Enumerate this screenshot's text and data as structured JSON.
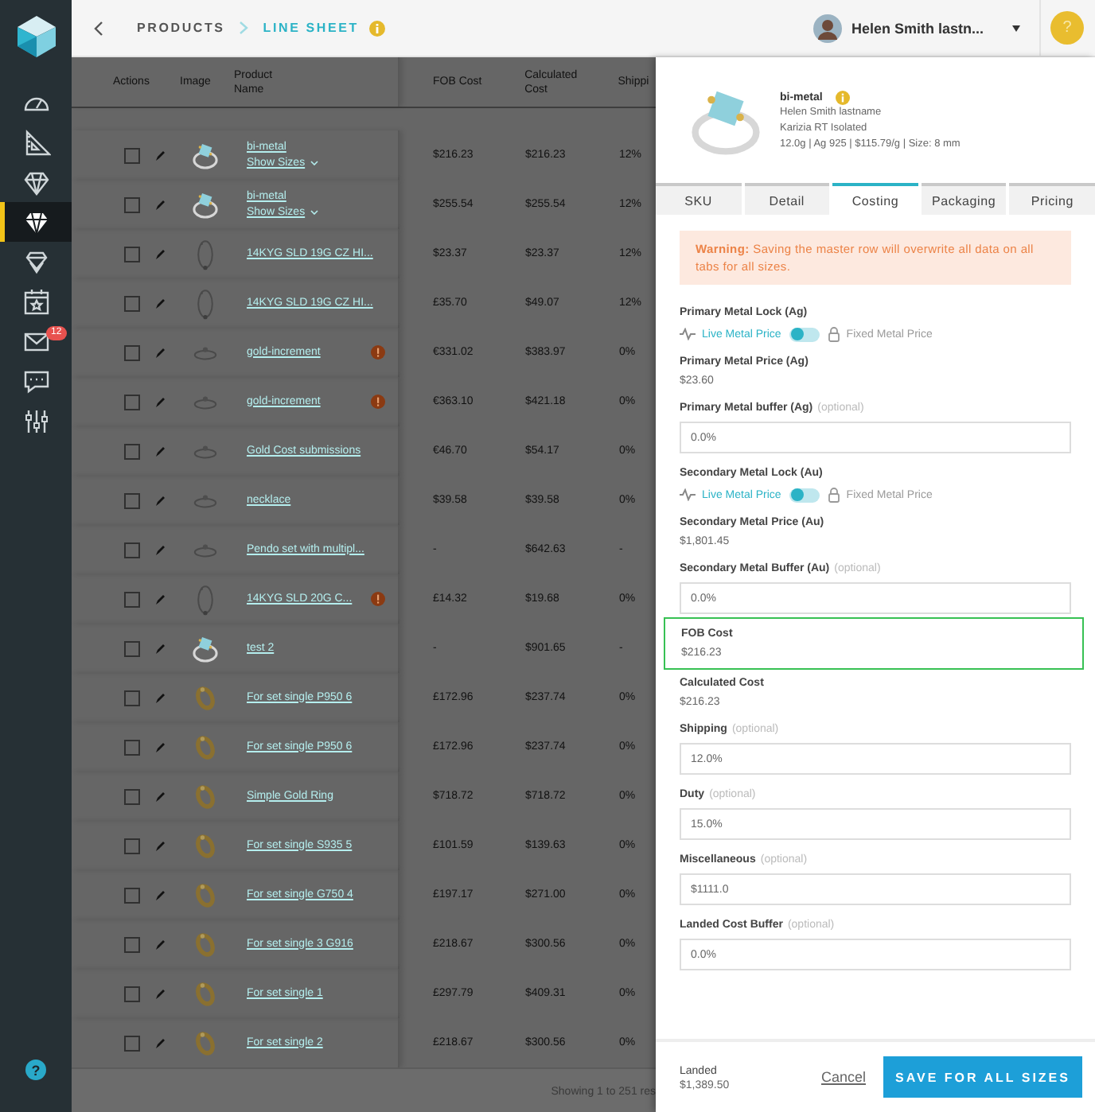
{
  "sidebar": {
    "items": [
      {
        "kind": "gauge",
        "selected": false
      },
      {
        "kind": "ruler",
        "selected": false
      },
      {
        "kind": "gem-outline",
        "selected": false
      },
      {
        "kind": "gem",
        "selected": true
      },
      {
        "kind": "gem-stack",
        "selected": false
      },
      {
        "kind": "calendar",
        "selected": false
      },
      {
        "kind": "mail",
        "selected": false,
        "badge": "12"
      },
      {
        "kind": "chat",
        "selected": false
      },
      {
        "kind": "sliders",
        "selected": false
      }
    ],
    "help": "?"
  },
  "breadcrumb": [
    {
      "label": "PRODUCTS",
      "current": false
    },
    {
      "label": "LINE SHEET",
      "current": true
    }
  ],
  "user": {
    "name": "Helen Smith lastn..."
  },
  "help_button": "?",
  "table": {
    "columns": [
      "Actions",
      "Image",
      "Product Name",
      "FOB Cost",
      "Calculated Cost",
      "Shippi"
    ],
    "rows": [
      {
        "checked": false,
        "name": "bi-metal",
        "show_sizes": "Show Sizes",
        "fob": "$216.23",
        "calculated": "$216.23",
        "shipping": "12%",
        "alert": false
      },
      {
        "checked": false,
        "name": "bi-metal",
        "show_sizes": "Show Sizes",
        "fob": "$255.54",
        "calculated": "$255.54",
        "shipping": "12%",
        "alert": false
      },
      {
        "checked": false,
        "name": "14KYG SLD 19G CZ HI...",
        "fob": "$23.37",
        "calculated": "$23.37",
        "shipping": "12%",
        "alert": false
      },
      {
        "checked": false,
        "name": "14KYG SLD 19G CZ HI...",
        "fob": "£35.70",
        "calculated": "$49.07",
        "shipping": "12%",
        "alert": false
      },
      {
        "checked": false,
        "name": "gold-increment",
        "fob": "€331.02",
        "calculated": "$383.97",
        "shipping": "0%",
        "alert": true
      },
      {
        "checked": false,
        "name": "gold-increment",
        "fob": "€363.10",
        "calculated": "$421.18",
        "shipping": "0%",
        "alert": true
      },
      {
        "checked": false,
        "name": "Gold Cost submissions",
        "fob": "€46.70",
        "calculated": "$54.17",
        "shipping": "0%",
        "alert": false
      },
      {
        "checked": false,
        "name": "necklace",
        "fob": "$39.58",
        "calculated": "$39.58",
        "shipping": "0%",
        "alert": false
      },
      {
        "checked": false,
        "name": "Pendo set with multipl...",
        "fob": "-",
        "calculated": "$642.63",
        "shipping": "-",
        "alert": false
      },
      {
        "checked": false,
        "name": "14KYG SLD 20G C...",
        "fob": "£14.32",
        "calculated": "$19.68",
        "shipping": "0%",
        "alert": true
      },
      {
        "checked": false,
        "name": "test 2",
        "fob": "-",
        "calculated": "$901.65",
        "shipping": "-",
        "alert": false
      },
      {
        "checked": false,
        "name": "For set single P950 6",
        "fob": "£172.96",
        "calculated": "$237.74",
        "shipping": "0%",
        "alert": false
      },
      {
        "checked": false,
        "name": "For set single P950 6",
        "fob": "£172.96",
        "calculated": "$237.74",
        "shipping": "0%",
        "alert": false
      },
      {
        "checked": false,
        "name": "Simple Gold Ring",
        "fob": "$718.72",
        "calculated": "$718.72",
        "shipping": "0%",
        "alert": false
      },
      {
        "checked": false,
        "name": "For set single S935 5",
        "fob": "£101.59",
        "calculated": "$139.63",
        "shipping": "0%",
        "alert": false
      },
      {
        "checked": false,
        "name": "For set single G750 4",
        "fob": "£197.17",
        "calculated": "$271.00",
        "shipping": "0%",
        "alert": false
      },
      {
        "checked": false,
        "name": "For set single 3 G916",
        "fob": "£218.67",
        "calculated": "$300.56",
        "shipping": "0%",
        "alert": false
      },
      {
        "checked": false,
        "name": "For set single 1",
        "fob": "£297.79",
        "calculated": "$409.31",
        "shipping": "0%",
        "alert": false
      },
      {
        "checked": false,
        "name": "For set single 2",
        "fob": "£218.67",
        "calculated": "$300.56",
        "shipping": "0%",
        "alert": false
      }
    ],
    "footer": "Showing 1 to 251 res"
  },
  "panel": {
    "product": {
      "name": "bi-metal",
      "owner": "Helen Smith lastname",
      "collection": "Karizia RT Isolated",
      "specs": "12.0g | Ag 925 | $115.79/g | Size: 8 mm"
    },
    "tabs": [
      {
        "label": "SKU",
        "selected": false
      },
      {
        "label": "Detail",
        "selected": false
      },
      {
        "label": "Costing",
        "selected": true
      },
      {
        "label": "Packaging",
        "selected": false
      },
      {
        "label": "Pricing",
        "selected": false
      }
    ],
    "warning": "**Warning:** Saving the master row will overwrite all data on all tabs for all sizes.",
    "fields": [
      {
        "kind": "toggle",
        "label": "Primary Metal Lock (Ag)",
        "live_label": "Live Metal Price",
        "fixed_label": "Fixed Metal Price",
        "fixed": false
      },
      {
        "kind": "value",
        "label": "Primary Metal Price (Ag)",
        "value": "$23.60",
        "highlighted": false
      },
      {
        "kind": "input",
        "label": "Primary Metal buffer (Ag)",
        "hint": "(optional)",
        "value": "0.0%"
      },
      {
        "kind": "toggle",
        "label": "Secondary Metal Lock (Au)",
        "live_label": "Live Metal Price",
        "fixed_label": "Fixed Metal Price",
        "fixed": false
      },
      {
        "kind": "value",
        "label": "Secondary Metal Price (Au)",
        "value": "$1,801.45",
        "highlighted": false
      },
      {
        "kind": "input",
        "label": "Secondary Metal Buffer (Au)",
        "hint": "(optional)",
        "value": "0.0%"
      },
      {
        "kind": "value",
        "label": "FOB Cost",
        "value": "$216.23",
        "highlighted": true
      },
      {
        "kind": "value",
        "label": "Calculated Cost",
        "value": "$216.23",
        "highlighted": false
      },
      {
        "kind": "input",
        "label": "Shipping",
        "hint": "(optional)",
        "value": "12.0%"
      },
      {
        "kind": "input",
        "label": "Duty",
        "hint": "(optional)",
        "value": "15.0%"
      },
      {
        "kind": "input",
        "label": "Miscellaneous",
        "hint": "(optional)",
        "value": "$1111.0"
      },
      {
        "kind": "input",
        "label": "Landed Cost Buffer",
        "hint": "(optional)",
        "value": "0.0%"
      }
    ],
    "footer": {
      "total_label": "Landed",
      "total": "$1,389.50",
      "cancel": "Cancel",
      "save": "SAVE FOR ALL SIZES"
    }
  }
}
